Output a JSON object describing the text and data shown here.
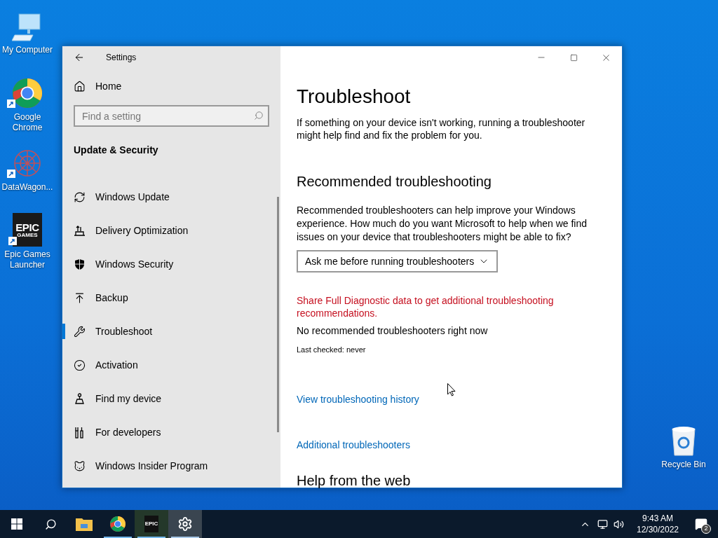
{
  "desktop_icons": [
    {
      "kind": "computer",
      "label": "My Computer",
      "shortcut": false
    },
    {
      "kind": "chrome",
      "label": "Google Chrome",
      "shortcut": true
    },
    {
      "kind": "datawagon",
      "label": "DataWagon...",
      "shortcut": true
    },
    {
      "kind": "epic",
      "label": "Epic Games Launcher",
      "shortcut": true,
      "logo": [
        "EPIC",
        "GAMES"
      ]
    },
    {
      "kind": "recycle",
      "label": "Recycle Bin",
      "shortcut": false
    }
  ],
  "window": {
    "title": "Settings"
  },
  "sidebar": {
    "home": "Home",
    "search": {
      "placeholder": "Find a setting"
    },
    "section": "Update & Security",
    "items": [
      {
        "kind": "update",
        "label": "Windows Update",
        "selected": false
      },
      {
        "kind": "delivery",
        "label": "Delivery Optimization",
        "selected": false
      },
      {
        "kind": "shield",
        "label": "Windows Security",
        "selected": false
      },
      {
        "kind": "backup",
        "label": "Backup",
        "selected": false
      },
      {
        "kind": "wrench",
        "label": "Troubleshoot",
        "selected": true
      },
      {
        "kind": "check",
        "label": "Activation",
        "selected": false
      },
      {
        "kind": "find",
        "label": "Find my device",
        "selected": false
      },
      {
        "kind": "dev",
        "label": "For developers",
        "selected": false
      },
      {
        "kind": "cat",
        "label": "Windows Insider Program",
        "selected": false
      }
    ]
  },
  "main": {
    "title": "Troubleshoot",
    "intro": "If something on your device isn't working, running a troubleshooter might help find and fix the problem for you.",
    "section": "Recommended troubleshooting",
    "description": "Recommended troubleshooters can help improve your Windows experience. How much do you want Microsoft to help when we find issues on your device that troubleshooters might be able to fix?",
    "dropdown": "Ask me before running troubleshooters",
    "diagnostic_link": "Share Full Diagnostic data to get additional troubleshooting recommendations.",
    "status": "No recommended troubleshooters right now",
    "last_checked": "Last checked: never",
    "links": [
      "View troubleshooting history",
      "Additional troubleshooters"
    ],
    "next_section": "Help from the web"
  },
  "taskbar": {
    "apps": [
      {
        "kind": "explorer",
        "open": false,
        "active": false
      },
      {
        "kind": "chrome",
        "open": true,
        "active": false
      },
      {
        "kind": "epic",
        "open": true,
        "active": false,
        "logo": "EPIC"
      },
      {
        "kind": "settings",
        "open": true,
        "active": true
      }
    ],
    "time": "9:43 AM",
    "date": "12/30/2022",
    "notifications": "2"
  }
}
